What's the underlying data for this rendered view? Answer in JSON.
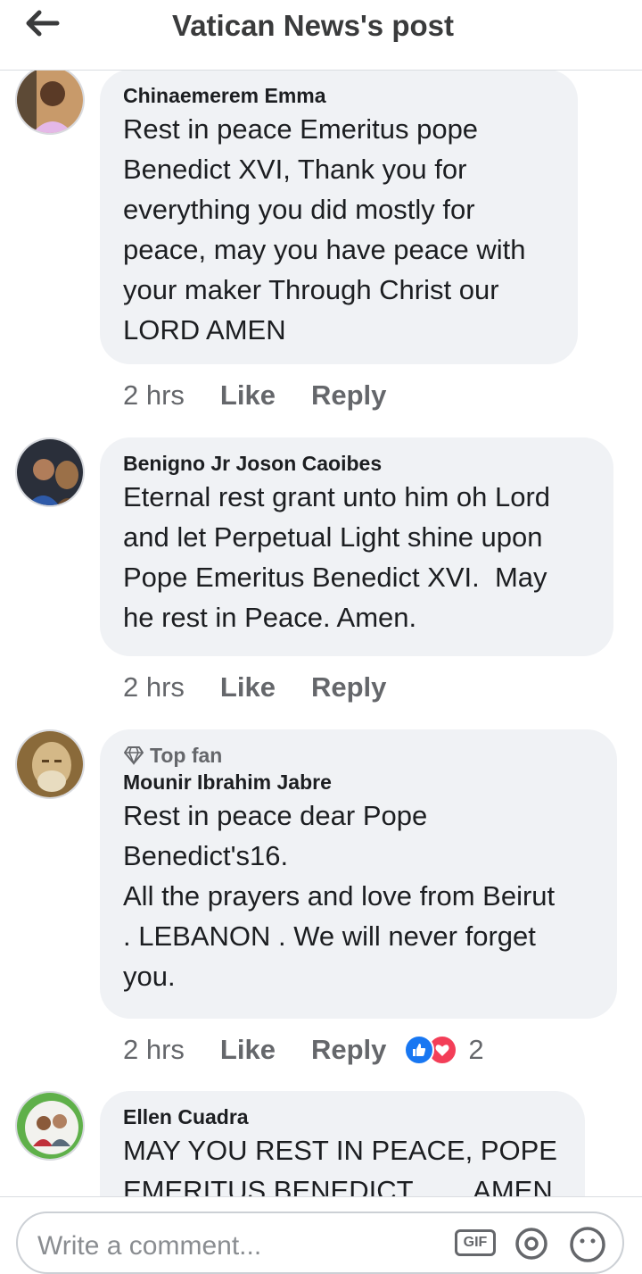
{
  "header": {
    "title": "Vatican News's post"
  },
  "comments": [
    {
      "author": "Chinaemerem Emma",
      "text": "Rest in peace Emeritus pope\nBenedict XVI, Thank you for\neverything you did mostly for\npeace, may you have peace with\nyour maker Through Christ our\nLORD AMEN",
      "time": "2 hrs",
      "like": "Like",
      "reply": "Reply"
    },
    {
      "author": "Benigno Jr Joson Caoibes",
      "text": "Eternal rest grant unto him oh Lord\nand let Perpetual Light shine upon\nPope Emeritus Benedict XVI.  May\nhe rest in Peace. Amen.",
      "time": "2 hrs",
      "like": "Like",
      "reply": "Reply"
    },
    {
      "badge": "Top fan",
      "author": "Mounir Ibrahim Jabre",
      "text": "Rest in peace dear Pope\nBenedict's16.\nAll the prayers and love from Beirut\n. LEBANON . We will never forget\nyou.",
      "time": "2 hrs",
      "like": "Like",
      "reply": "Reply",
      "reaction_count": "2"
    },
    {
      "author": "Ellen Cuadra",
      "text": "MAY YOU REST IN PEACE, POPE\nEMERITUS BENEDICT ...... AMEN"
    }
  ],
  "composer": {
    "placeholder": "Write a comment...",
    "gif_label": "GIF"
  },
  "icons": {
    "back": "arrow-left-icon",
    "gif": "gif-icon",
    "mention": "at-icon",
    "emoji": "smiley-icon",
    "top_fan": "diamond-icon",
    "like_reaction": "thumbs-up-icon",
    "love_reaction": "heart-icon"
  },
  "colors": {
    "bubble": "#f0f2f5",
    "like_blue": "#1877f2",
    "love_red": "#f33e58",
    "secondary_text": "#65676b"
  }
}
